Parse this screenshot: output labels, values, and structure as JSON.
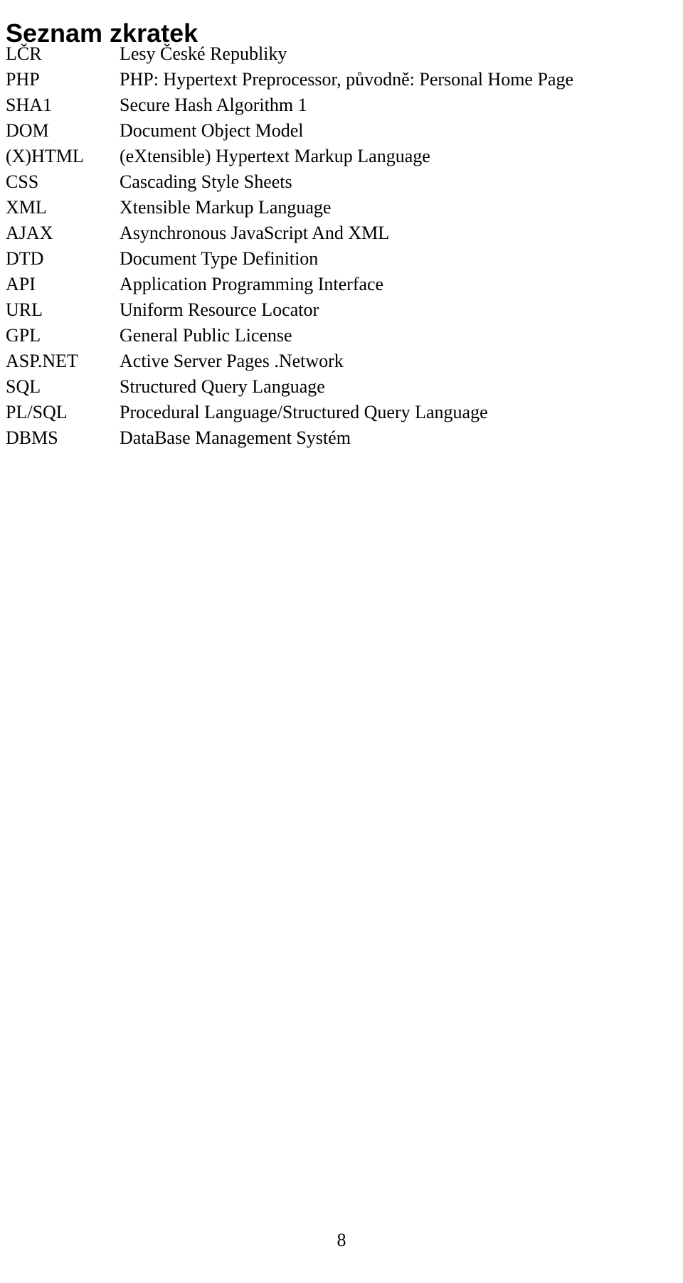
{
  "document": {
    "heading": "Seznam zkratek",
    "page_number": "8"
  },
  "abbreviations": [
    {
      "term": "LČR",
      "definition": "Lesy České Republiky"
    },
    {
      "term": "PHP",
      "definition": "PHP: Hypertext Preprocessor, původně: Personal Home Page"
    },
    {
      "term": "SHA1",
      "definition": "Secure Hash Algorithm 1"
    },
    {
      "term": "DOM",
      "definition": "Document Object Model"
    },
    {
      "term": "(X)HTML",
      "definition": "(eXtensible) Hypertext Markup Language"
    },
    {
      "term": "CSS",
      "definition": "Cascading Style Sheets"
    },
    {
      "term": "XML",
      "definition": "Xtensible Markup Language"
    },
    {
      "term": "AJAX",
      "definition": "Asynchronous JavaScript And XML"
    },
    {
      "term": "DTD",
      "definition": "Document Type Definition"
    },
    {
      "term": "API",
      "definition": "Application Programming Interface"
    },
    {
      "term": "URL",
      "definition": "Uniform Resource Locator"
    },
    {
      "term": "GPL",
      "definition": "General Public License"
    },
    {
      "term": "ASP.NET",
      "definition": "Active Server Pages .Network"
    },
    {
      "term": "SQL",
      "definition": "Structured Query Language"
    },
    {
      "term": "PL/SQL",
      "definition": "Procedural Language/Structured Query Language"
    },
    {
      "term": "DBMS",
      "definition": "DataBase Management Systém"
    }
  ]
}
